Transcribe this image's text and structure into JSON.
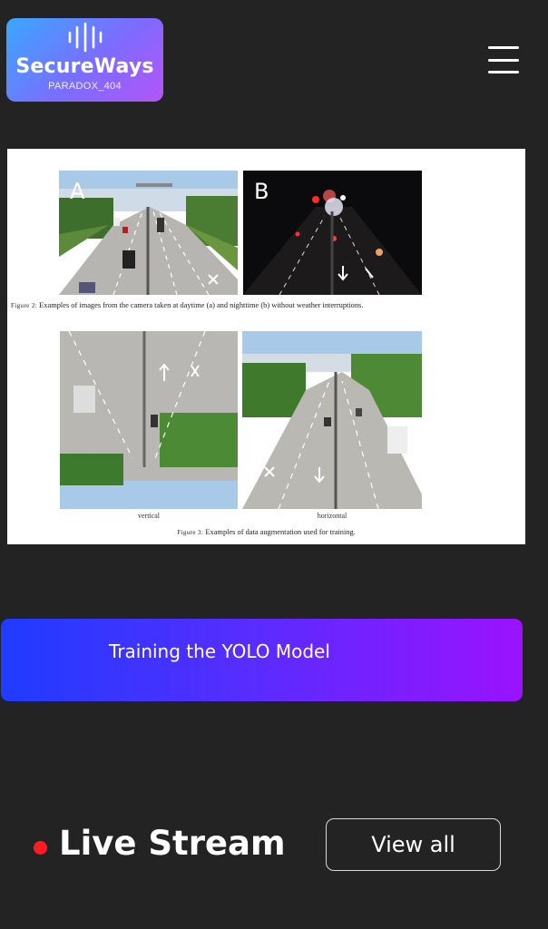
{
  "header": {
    "brand": "SecureWays",
    "tagline": "PARADOX_404",
    "menu_icon": "hamburger-menu-icon"
  },
  "figure": {
    "panels_row1": [
      {
        "tag": "A",
        "scene": "highway-daytime"
      },
      {
        "tag": "B",
        "scene": "highway-nighttime"
      }
    ],
    "caption2_label": "Figure 2:",
    "caption2_text": "Examples of images from the camera taken at daytime (a) and nighttime (b) without weather interruptions.",
    "panels_row2": [
      {
        "label": "vertical",
        "scene": "highway-flipped-vertical"
      },
      {
        "label": "horizontal",
        "scene": "highway-flipped-horizontal"
      }
    ],
    "caption3_label": "Figure 3:",
    "caption3_text": "Examples of data augmentation used for training."
  },
  "topic_button": {
    "label": "Training the YOLO Model"
  },
  "live": {
    "title": "Live Stream",
    "view_all_label": "View all",
    "status_color": "#ff1b24"
  },
  "colors": {
    "background": "#232323",
    "accent_start": "#1f3cff",
    "accent_end": "#9b12ff"
  }
}
